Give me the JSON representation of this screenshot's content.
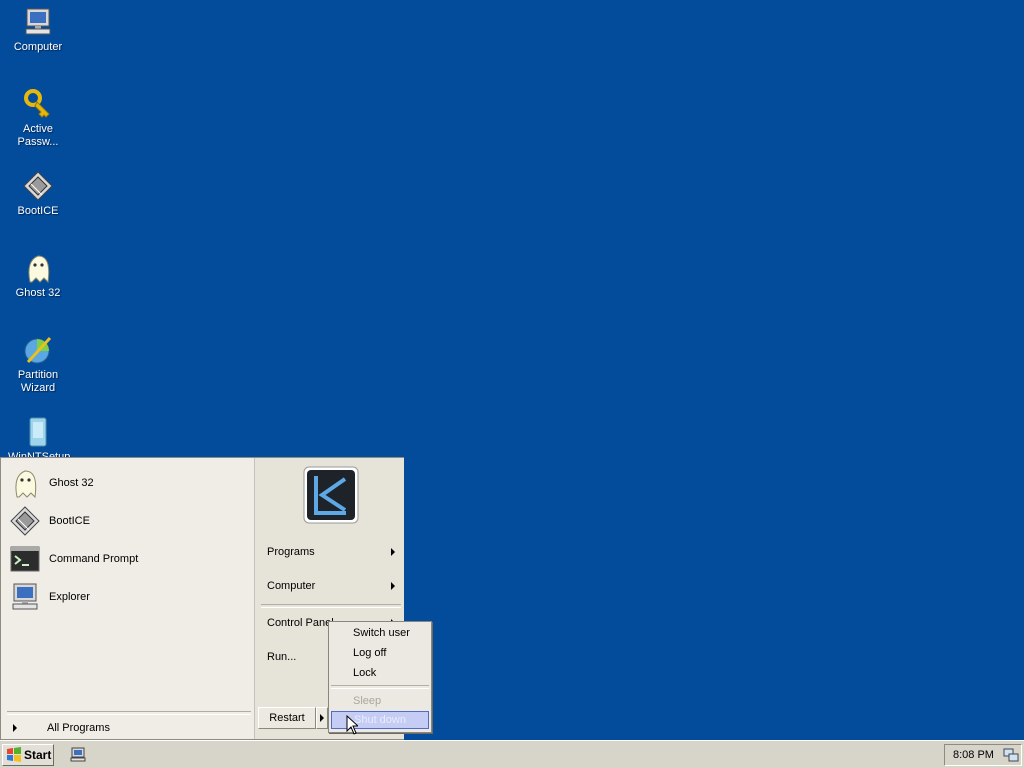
{
  "desktop": {
    "icons": [
      {
        "label": "Computer",
        "icon": "computer-icon"
      },
      {
        "label": "Active Passw...",
        "icon": "key-icon"
      },
      {
        "label": "BootICE",
        "icon": "bootice-icon"
      },
      {
        "label": "Ghost 32",
        "icon": "ghost-icon"
      },
      {
        "label": "Partition Wizard",
        "icon": "partition-wizard-icon"
      },
      {
        "label": "WinNTSetup",
        "icon": "winntsetup-icon"
      }
    ]
  },
  "start_menu": {
    "pinned": [
      {
        "label": "Ghost 32",
        "icon": "ghost-icon"
      },
      {
        "label": "BootICE",
        "icon": "bootice-icon"
      },
      {
        "label": "Command Prompt",
        "icon": "command-prompt-icon"
      },
      {
        "label": "Explorer",
        "icon": "explorer-icon"
      }
    ],
    "all_programs_label": "All Programs",
    "right_items": [
      {
        "label": "Programs",
        "has_submenu": true
      },
      {
        "label": "Computer",
        "has_submenu": true
      },
      {
        "label": "Control Panel",
        "has_submenu": true
      },
      {
        "label": "Run...",
        "has_submenu": false
      }
    ],
    "restart_label": "Restart",
    "power_menu": {
      "items": [
        {
          "label": "Switch user",
          "enabled": true,
          "highlighted": false
        },
        {
          "label": "Log off",
          "enabled": true,
          "highlighted": false
        },
        {
          "label": "Lock",
          "enabled": true,
          "highlighted": false
        },
        {
          "label": "Sleep",
          "enabled": false,
          "highlighted": false
        },
        {
          "label": "Shut down",
          "enabled": true,
          "highlighted": true
        }
      ]
    }
  },
  "taskbar": {
    "start_label": "Start",
    "clock": "8:08 PM"
  },
  "colors": {
    "desktop_background": "#024c9b",
    "menu_background": "#ebe9e2",
    "highlight": "#c5cdf4",
    "taskbar": "#d7d4ca"
  }
}
